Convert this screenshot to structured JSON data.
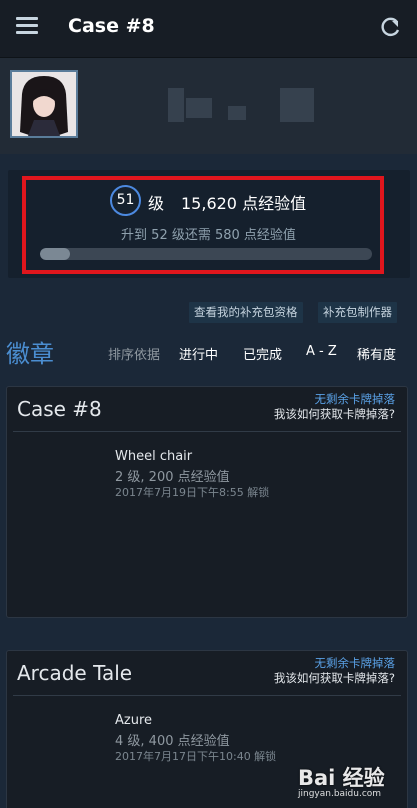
{
  "header": {
    "title": "Case #8"
  },
  "level": {
    "level_number": "51",
    "level_suffix": "级",
    "xp_label": "15,620 点经验值",
    "next_level_text": "升到 52 级还需 580 点经验值",
    "progress_fraction": 0.09
  },
  "buttons": {
    "booster_eligibility": "查看我的补充包资格",
    "booster_creator": "补充包制作器"
  },
  "badges": {
    "title": "徽章",
    "sort_label": "排序依据",
    "sort_options": [
      "进行中",
      "已完成",
      "A - Z",
      "稀有度"
    ]
  },
  "cards": [
    {
      "name": "Case #8",
      "drops_label": "无剩余卡牌掉落",
      "how_label": "我该如何获取卡牌掉落?",
      "badge_name": "Wheel chair",
      "badge_xp": "2 级, 200 点经验值",
      "badge_date": "2017年7月19日下午8:55 解锁"
    },
    {
      "name": "Arcade Tale",
      "drops_label": "无剩余卡牌掉落",
      "how_label": "我该如何获取卡牌掉落?",
      "badge_name": "Azure",
      "badge_xp": "4 级, 400 点经验值",
      "badge_date": "2017年7月17日下午10:40 解锁"
    }
  ],
  "watermark": {
    "logo": "Bai 经验",
    "url": "jingyan.baidu.com"
  },
  "colors": {
    "background": "#1b2838",
    "accent": "#4b8ed1",
    "highlight": "#e0161d"
  }
}
